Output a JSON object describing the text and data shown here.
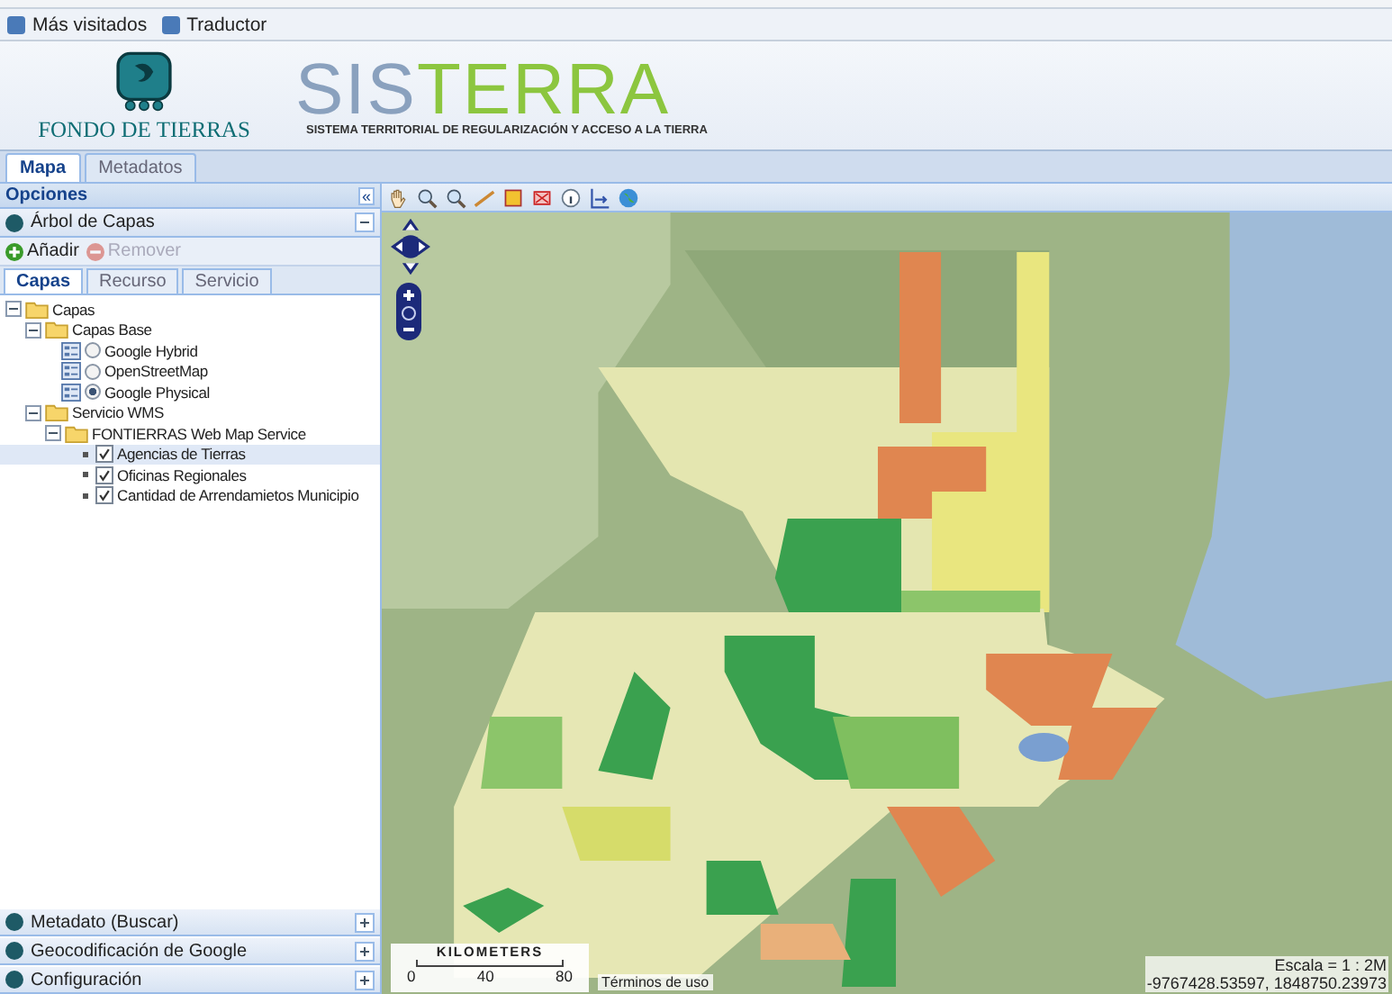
{
  "bookmarks": [
    {
      "label": "Más visitados"
    },
    {
      "label": "Traductor"
    }
  ],
  "header": {
    "org_name": "FONDO DE TIERRAS",
    "title_a": "SIS",
    "title_b": "TERRA",
    "subtitle": "SISTEMA TERRITORIAL DE REGULARIZACIÓN Y ACCESO A LA TIERRA"
  },
  "tabs": [
    {
      "label": "Mapa",
      "selected": true
    },
    {
      "label": "Metadatos",
      "selected": false
    }
  ],
  "sidebar": {
    "title": "Opciones",
    "collapse_glyph": "«",
    "sections": [
      {
        "title": "Árbol de Capas",
        "expanded": true
      },
      {
        "title": "Metadato (Buscar)",
        "expanded": false
      },
      {
        "title": "Geocodificación de Google",
        "expanded": false
      },
      {
        "title": "Configuración",
        "expanded": false
      }
    ],
    "actions": [
      {
        "label": "Añadir",
        "disabled": false
      },
      {
        "label": "Remover",
        "disabled": true
      }
    ],
    "tabs": [
      {
        "label": "Capas",
        "selected": true
      },
      {
        "label": "Recurso",
        "selected": false
      },
      {
        "label": "Servicio",
        "selected": false
      }
    ],
    "tree": [
      {
        "kind": "folder",
        "label": "Capas",
        "expanded": true,
        "children": [
          {
            "kind": "folder",
            "label": "Capas Base",
            "expanded": true,
            "children": [
              {
                "kind": "radio",
                "label": "Google Hybrid",
                "selected": false
              },
              {
                "kind": "radio",
                "label": "OpenStreetMap",
                "selected": false
              },
              {
                "kind": "radio",
                "label": "Google Physical",
                "selected": true
              }
            ]
          },
          {
            "kind": "folder",
            "label": "Servicio WMS",
            "expanded": true,
            "children": [
              {
                "kind": "folder",
                "label": "FONTIERRAS Web Map Service",
                "expanded": true,
                "children": [
                  {
                    "kind": "check",
                    "label": "Agencias de Tierras",
                    "checked": true,
                    "selected": true
                  },
                  {
                    "kind": "check",
                    "label": "Oficinas Regionales",
                    "checked": true,
                    "selected": false
                  },
                  {
                    "kind": "check",
                    "label": "Cantidad de Arrendamietos Municipio",
                    "checked": true,
                    "selected": false
                  }
                ]
              }
            ]
          }
        ]
      }
    ]
  },
  "map": {
    "scale_unit": "KILOMETERS",
    "scale_ticks": [
      "0",
      "40",
      "80"
    ],
    "terms": "Términos de uso",
    "scale": "Escala = 1 : 2M",
    "coordinates": "-9767428.53597, 1848750.23973"
  }
}
